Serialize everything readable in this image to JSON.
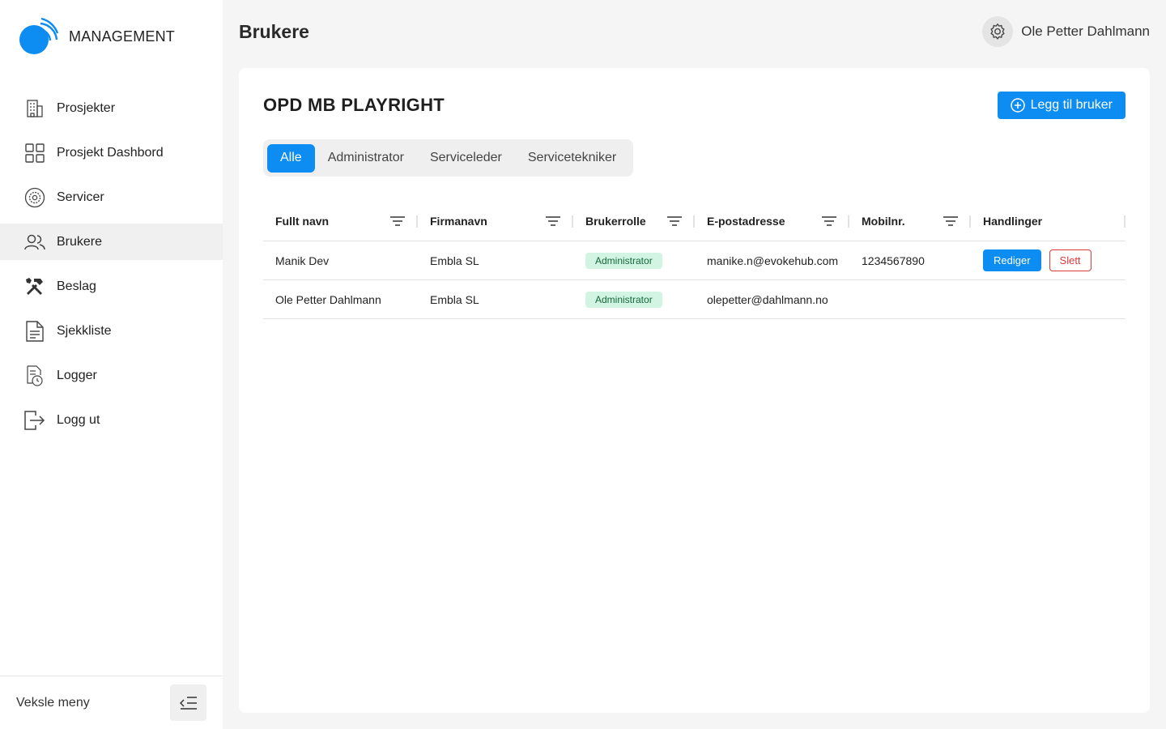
{
  "app": {
    "brand": "MANAGEMENT",
    "brand_color": "#0d8cf2"
  },
  "sidebar": {
    "items": [
      {
        "label": "Prosjekter",
        "icon": "building-icon"
      },
      {
        "label": "Prosjekt Dashbord",
        "icon": "grid-icon"
      },
      {
        "label": "Servicer",
        "icon": "service-gear-icon"
      },
      {
        "label": "Brukere",
        "icon": "users-icon",
        "active": true
      },
      {
        "label": "Beslag",
        "icon": "tools-icon"
      },
      {
        "label": "Sjekkliste",
        "icon": "document-icon"
      },
      {
        "label": "Logger",
        "icon": "log-clock-icon"
      },
      {
        "label": "Logg ut",
        "icon": "logout-icon"
      }
    ],
    "footer_label": "Veksle meny"
  },
  "header": {
    "title": "Brukere",
    "user_name": "Ole Petter Dahlmann"
  },
  "main": {
    "card_title": "OPD MB PLAYRIGHT",
    "add_button_label": "Legg til bruker",
    "tabs": [
      {
        "label": "Alle",
        "active": true
      },
      {
        "label": "Administrator"
      },
      {
        "label": "Serviceleder"
      },
      {
        "label": "Servicetekniker"
      }
    ],
    "table": {
      "columns": [
        "Fullt navn",
        "Firmanavn",
        "Brukerrolle",
        "E-postadresse",
        "Mobilnr.",
        "Handlinger"
      ],
      "rows": [
        {
          "name": "Manik Dev",
          "company": "Embla SL",
          "role": "Administrator",
          "email": "manike.n@evokehub.com",
          "mobile": "1234567890",
          "edit": "Rediger",
          "delete": "Slett"
        },
        {
          "name": "Ole Petter Dahlmann",
          "company": "Embla SL",
          "role": "Administrator",
          "email": "olepetter@dahlmann.no",
          "mobile": ""
        }
      ]
    }
  }
}
